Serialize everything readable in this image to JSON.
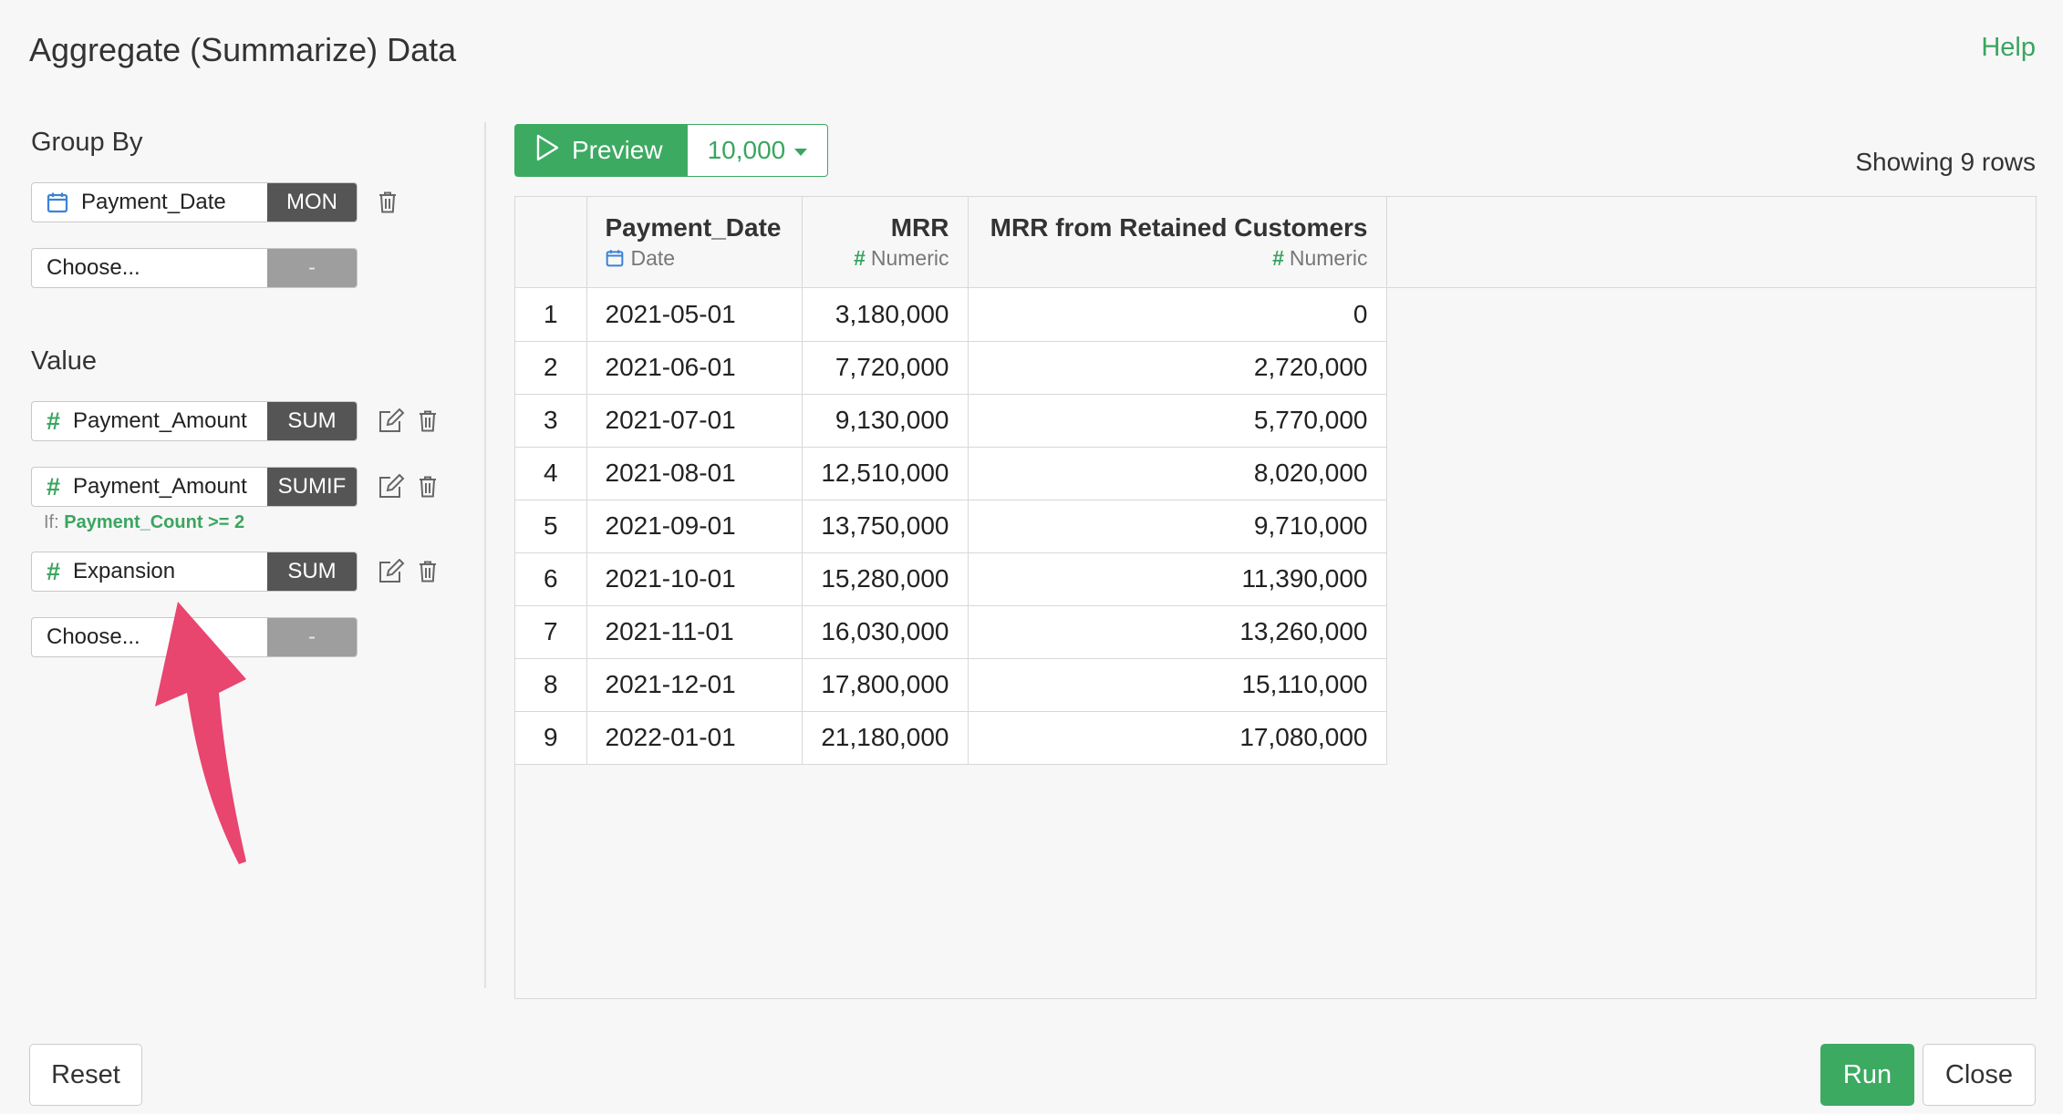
{
  "dialog": {
    "title": "Aggregate (Summarize) Data",
    "help_label": "Help"
  },
  "group_by": {
    "label": "Group By",
    "fields": [
      {
        "name": "Payment_Date",
        "icon": "calendar-icon",
        "function": "MON"
      }
    ],
    "chooser": {
      "placeholder": "Choose...",
      "function": "-"
    }
  },
  "value": {
    "label": "Value",
    "fields": [
      {
        "name": "Payment_Amount",
        "icon": "hash-icon",
        "function": "SUM",
        "condition": null
      },
      {
        "name": "Payment_Amount",
        "icon": "hash-icon",
        "function": "SUMIF",
        "condition_prefix": "If:",
        "condition": "Payment_Count >= 2"
      },
      {
        "name": "Expansion",
        "icon": "hash-icon",
        "function": "SUM",
        "condition": null
      }
    ],
    "chooser": {
      "placeholder": "Choose...",
      "function": "-"
    }
  },
  "preview": {
    "button_label": "Preview",
    "rows_limit": "10,000",
    "showing_text": "Showing 9 rows"
  },
  "table": {
    "columns": [
      {
        "name": "Payment_Date",
        "type": "Date",
        "type_icon": "calendar-icon"
      },
      {
        "name": "MRR",
        "type": "Numeric",
        "type_icon": "hash-icon"
      },
      {
        "name": "MRR from Retained Customers",
        "type": "Numeric",
        "type_icon": "hash-icon"
      }
    ],
    "rows": [
      [
        "1",
        "2021-05-01",
        "3,180,000",
        "0"
      ],
      [
        "2",
        "2021-06-01",
        "7,720,000",
        "2,720,000"
      ],
      [
        "3",
        "2021-07-01",
        "9,130,000",
        "5,770,000"
      ],
      [
        "4",
        "2021-08-01",
        "12,510,000",
        "8,020,000"
      ],
      [
        "5",
        "2021-09-01",
        "13,750,000",
        "9,710,000"
      ],
      [
        "6",
        "2021-10-01",
        "15,280,000",
        "11,390,000"
      ],
      [
        "7",
        "2021-11-01",
        "16,030,000",
        "13,260,000"
      ],
      [
        "8",
        "2021-12-01",
        "17,800,000",
        "15,110,000"
      ],
      [
        "9",
        "2022-01-01",
        "21,180,000",
        "17,080,000"
      ]
    ]
  },
  "footer": {
    "reset_label": "Reset",
    "run_label": "Run",
    "close_label": "Close"
  },
  "colors": {
    "accent": "#3daa62",
    "badge": "#555555",
    "annotation_arrow": "#e8456f"
  }
}
